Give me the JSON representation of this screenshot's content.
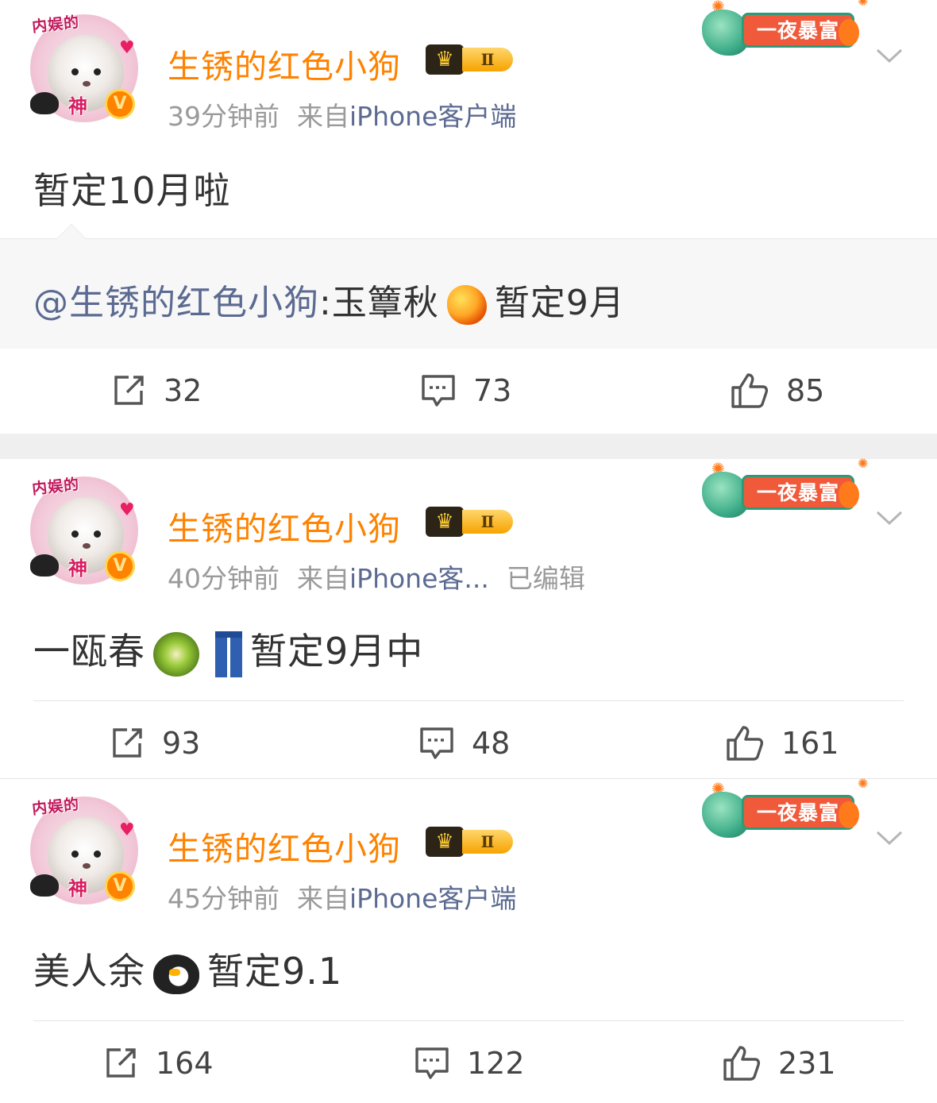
{
  "posts": [
    {
      "username": "生锈的红色小狗",
      "vip_level": "Ⅱ",
      "time": "39分钟前",
      "source_prefix": "来自",
      "source": "iPhone客户端",
      "edited": "",
      "ribbon": "一夜暴富",
      "avatar_tag": "内娱的",
      "avatar_god": "神",
      "text": "暂定10月啦",
      "quote": {
        "mention": "@生锈的红色小狗",
        "text_before": ":玉簟秋",
        "emoji": "mango",
        "text_after": "暂定9月"
      },
      "reposts": "32",
      "comments": "73",
      "likes": "85"
    },
    {
      "username": "生锈的红色小狗",
      "vip_level": "Ⅱ",
      "time": "40分钟前",
      "source_prefix": "来自",
      "source": "iPhone客...",
      "edited": "已编辑",
      "ribbon": "一夜暴富",
      "avatar_tag": "内娱的",
      "avatar_god": "神",
      "text_before": "一瓯春",
      "emojis": [
        "kiwi",
        "jeans"
      ],
      "text_after": "暂定9月中",
      "reposts": "93",
      "comments": "48",
      "likes": "161"
    },
    {
      "username": "生锈的红色小狗",
      "vip_level": "Ⅱ",
      "time": "45分钟前",
      "source_prefix": "来自",
      "source": "iPhone客户端",
      "edited": "",
      "ribbon": "一夜暴富",
      "avatar_tag": "内娱的",
      "avatar_god": "神",
      "text_before": "美人余",
      "emojis": [
        "penguin"
      ],
      "text_after": "暂定9.1",
      "reposts": "164",
      "comments": "122",
      "likes": "231"
    }
  ],
  "colors": {
    "username": "#ff8200",
    "link": "#5b6a91",
    "meta": "#9a9a9a",
    "ribbon": "#f05a3a"
  },
  "icons": [
    "repost-icon",
    "comment-icon",
    "like-icon",
    "chevron-down-icon"
  ]
}
